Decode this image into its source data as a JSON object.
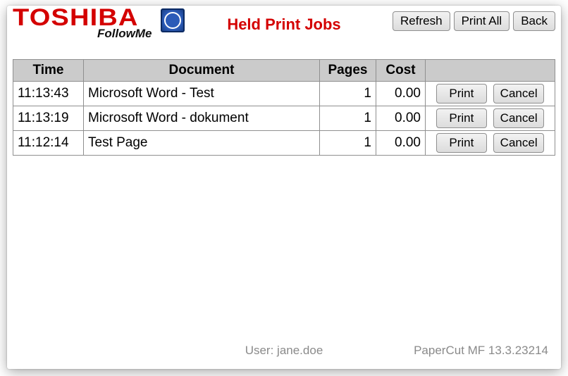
{
  "brand": {
    "name": "TOSHIBA",
    "subname": "FollowMe"
  },
  "header": {
    "title": "Held Print Jobs",
    "buttons": {
      "refresh": "Refresh",
      "print_all": "Print All",
      "back": "Back"
    }
  },
  "table": {
    "columns": {
      "time": "Time",
      "document": "Document",
      "pages": "Pages",
      "cost": "Cost"
    },
    "rows": [
      {
        "time": "11:13:43",
        "document": "Microsoft Word - Test",
        "pages": "1",
        "cost": "0.00"
      },
      {
        "time": "11:13:19",
        "document": "Microsoft Word - dokument",
        "pages": "1",
        "cost": "0.00"
      },
      {
        "time": "11:12:14",
        "document": "Test Page",
        "pages": "1",
        "cost": "0.00"
      }
    ],
    "row_buttons": {
      "print": "Print",
      "cancel": "Cancel"
    }
  },
  "footer": {
    "user_label": "User: jane.doe",
    "app_label": "PaperCut MF 13.3.23214"
  }
}
